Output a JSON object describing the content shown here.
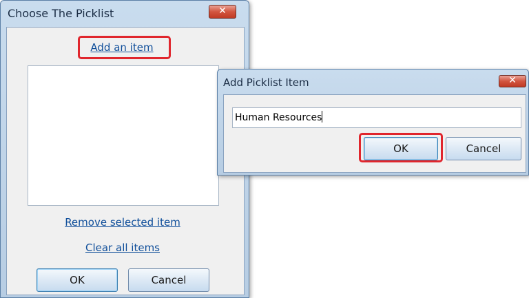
{
  "picklist_dialog": {
    "title": "Choose The Picklist",
    "close_glyph": "✕",
    "add_link": "Add an item",
    "remove_link": "Remove selected item",
    "clear_link": "Clear all items",
    "ok_label": "OK",
    "cancel_label": "Cancel",
    "list_items": []
  },
  "add_item_dialog": {
    "title": "Add Picklist Item",
    "close_glyph": "✕",
    "input_value": "Human Resources",
    "ok_label": "OK",
    "cancel_label": "Cancel"
  },
  "colors": {
    "highlight": "#e0262d",
    "link": "#0f4e9a",
    "titlebar": "#c9dcee"
  }
}
